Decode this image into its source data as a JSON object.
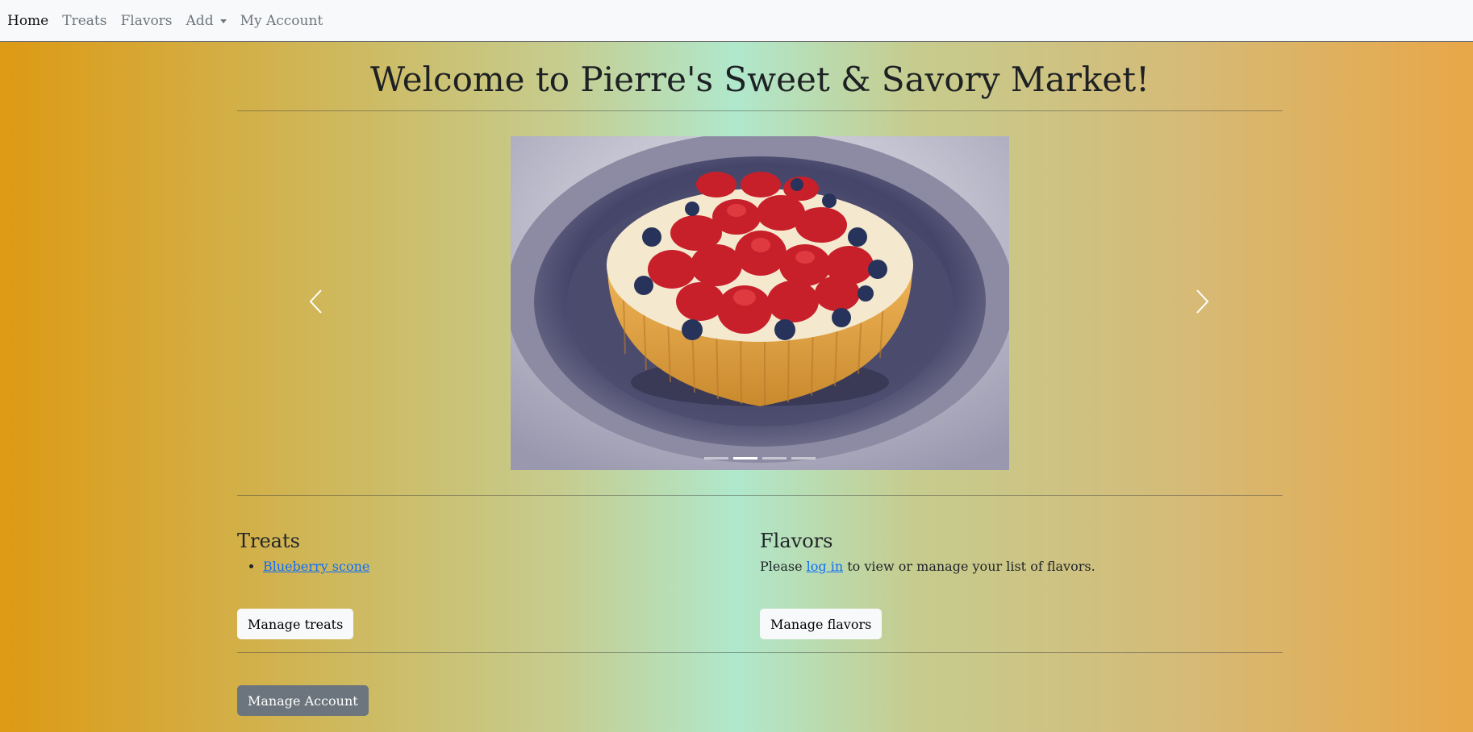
{
  "nav": {
    "items": [
      {
        "label": "Home",
        "active": true
      },
      {
        "label": "Treats"
      },
      {
        "label": "Flavors"
      },
      {
        "label": "Add",
        "dropdown": true
      },
      {
        "label": "My Account"
      }
    ]
  },
  "main": {
    "title": "Welcome to Pierre's Sweet & Savory Market!",
    "carousel": {
      "image": "fruit-tart",
      "active_index": 1,
      "slide_count": 4
    },
    "treats": {
      "heading": "Treats",
      "items": [
        "Blueberry scone"
      ],
      "button_label": "Manage treats"
    },
    "flavors": {
      "heading": "Flavors",
      "message_prefix": "Please ",
      "login_link": "log in",
      "message_suffix": " to view or manage your list of flavors.",
      "button_label": "Manage flavors"
    },
    "account_button_label": "Manage Account"
  },
  "colors": {
    "navbar_bg": "#f8f9fa",
    "link": "#0d6efd",
    "secondary_button": "#6c757d"
  }
}
